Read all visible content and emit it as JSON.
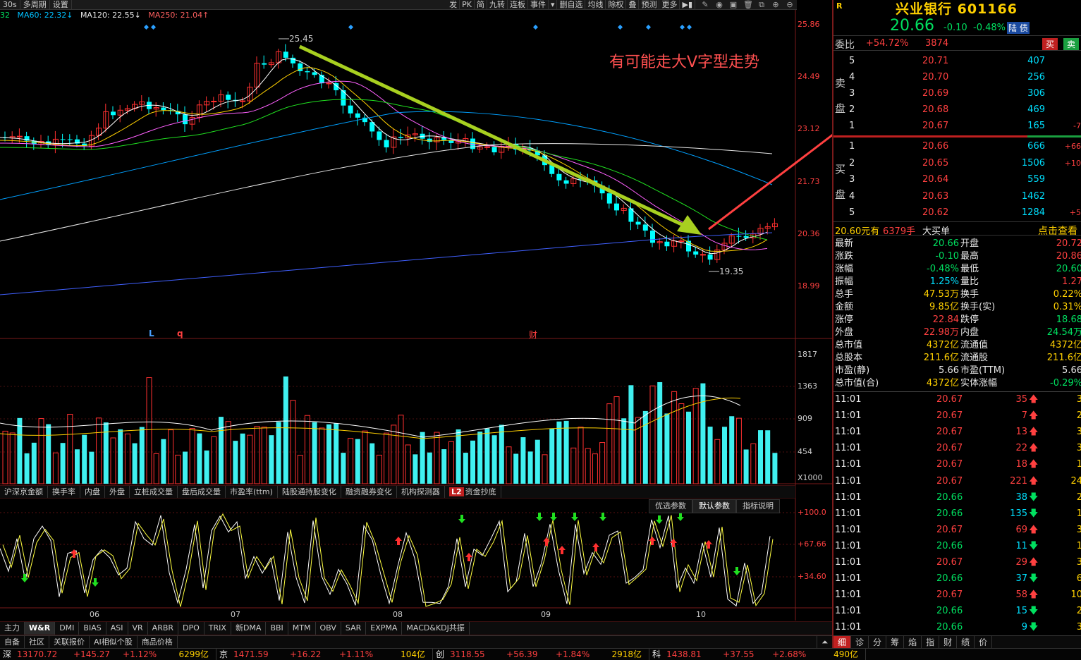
{
  "toolbar": {
    "period": "30s",
    "multi_period": "多周期",
    "settings": "设置",
    "tools": [
      "发",
      "PK",
      "简",
      "九转",
      "连板",
      "事件",
      "▾",
      "删自选",
      "均线",
      "除权",
      "叠",
      "预测",
      "更多",
      "▶▮"
    ]
  },
  "ma_legend": {
    "ma30_suffix": "32",
    "ma60": "MA60: 22.32↓",
    "ma120": "MA120: 22.55↓",
    "ma250": "MA250: 21.04↑",
    "colors": {
      "ma30": "#ffffff",
      "ma60": "#00c0ff",
      "ma120": "#ffffff",
      "ma250": "#ff6060"
    }
  },
  "price_axis": [
    "25.86",
    "24.49",
    "23.12",
    "21.73",
    "20.36",
    "18.99"
  ],
  "chart_annotations": {
    "high_label": "25.45",
    "low_label": "19.35",
    "caption": "有可能走大V字型走势",
    "markers": [
      "L",
      "q",
      "财"
    ]
  },
  "volume_axis": [
    "1817",
    "1363",
    "909",
    "454",
    "X1000"
  ],
  "indicator_tabs": [
    "沪深京金额",
    "换手率",
    "内盘",
    "外盘",
    "立桩成交量",
    "盘后成交量",
    "市盈率(ttm)",
    "陆股通持股变化",
    "融资融券变化",
    "机构探测器",
    "资金抄底"
  ],
  "indicator_badge": "L2",
  "param_tabs": [
    "优选参数",
    "默认参数",
    "指标说明"
  ],
  "wr_axis": [
    "+100.0",
    "+67.66",
    "+34.60"
  ],
  "month_labels": [
    "06",
    "07",
    "08",
    "09",
    "10"
  ],
  "bottom_tabs": [
    "主力",
    "W&R",
    "DMI",
    "BIAS",
    "ASI",
    "VR",
    "ARBR",
    "DPO",
    "TRIX",
    "新DMA",
    "BBI",
    "MTM",
    "OBV",
    "SAR",
    "EXPMA",
    "MACD&KDJ共振"
  ],
  "bottom_tabs2": [
    "自备",
    "社区",
    "关联报价",
    "AI相似个股",
    "商品价格"
  ],
  "status": [
    {
      "name": "深",
      "value": "13170.72",
      "change": "+145.27",
      "pct": "+1.12%",
      "amount": "6299亿"
    },
    {
      "name": "京",
      "value": "1471.59",
      "change": "+16.22",
      "pct": "+1.11%",
      "amount": "104亿"
    },
    {
      "name": "创",
      "value": "3118.55",
      "change": "+56.39",
      "pct": "+1.84%",
      "amount": "2918亿"
    },
    {
      "name": "科",
      "value": "1438.81",
      "change": "+37.55",
      "pct": "+2.68%",
      "amount": "490亿"
    }
  ],
  "quote": {
    "r_label": "R",
    "name": "兴业银行 601166",
    "price": "20.66",
    "change": "-0.10",
    "pct": "-0.48%",
    "tag": "陆 债",
    "weibi_label": "委比",
    "weibi": "+54.72%",
    "weicha": "3874",
    "buy_btn": "买",
    "sell_btn": "卖",
    "sell_label": "卖盘",
    "buy_label": "买盘",
    "asks": [
      {
        "lvl": "5",
        "price": "20.71",
        "vol": "407",
        "extra": ""
      },
      {
        "lvl": "4",
        "price": "20.70",
        "vol": "256",
        "extra": ""
      },
      {
        "lvl": "3",
        "price": "20.69",
        "vol": "306",
        "extra": ""
      },
      {
        "lvl": "2",
        "price": "20.68",
        "vol": "469",
        "extra": ""
      },
      {
        "lvl": "1",
        "price": "20.67",
        "vol": "165",
        "extra": "-7"
      }
    ],
    "bids": [
      {
        "lvl": "1",
        "price": "20.66",
        "vol": "666",
        "extra": "+66"
      },
      {
        "lvl": "2",
        "price": "20.65",
        "vol": "1506",
        "extra": "+10"
      },
      {
        "lvl": "3",
        "price": "20.64",
        "vol": "559",
        "extra": ""
      },
      {
        "lvl": "4",
        "price": "20.63",
        "vol": "1462",
        "extra": ""
      },
      {
        "lvl": "5",
        "price": "20.62",
        "vol": "1284",
        "extra": "+5"
      }
    ],
    "big_order": {
      "price": "20.60元有",
      "hands": "6379手",
      "type": "大买单",
      "link": "点击查看"
    },
    "stats": [
      {
        "k1": "最新",
        "v1": "20.66",
        "c1": "g",
        "k2": "开盘",
        "v2": "20.72",
        "c2": "r"
      },
      {
        "k1": "涨跌",
        "v1": "-0.10",
        "c1": "g",
        "k2": "最高",
        "v2": "20.86",
        "c2": "r"
      },
      {
        "k1": "涨幅",
        "v1": "-0.48%",
        "c1": "g",
        "k2": "最低",
        "v2": "20.60",
        "c2": "g"
      },
      {
        "k1": "振幅",
        "v1": "1.25%",
        "c1": "c",
        "k2": "量比",
        "v2": "1.27",
        "c2": "r"
      },
      {
        "k1": "总手",
        "v1": "47.53万",
        "c1": "y",
        "k2": "换手",
        "v2": "0.22%",
        "c2": "y"
      },
      {
        "k1": "金额",
        "v1": "9.85亿",
        "c1": "y",
        "k2": "换手(实)",
        "v2": "0.31%",
        "c2": "y"
      },
      {
        "k1": "涨停",
        "v1": "22.84",
        "c1": "r",
        "k2": "跌停",
        "v2": "18.68",
        "c2": "g"
      },
      {
        "k1": "外盘",
        "v1": "22.98万",
        "c1": "r",
        "k2": "内盘",
        "v2": "24.54万",
        "c2": "g"
      },
      {
        "k1": "总市值",
        "v1": "4372亿",
        "c1": "y",
        "k2": "流通值",
        "v2": "4372亿",
        "c2": "y"
      },
      {
        "k1": "总股本",
        "v1": "211.6亿",
        "c1": "y",
        "k2": "流通股",
        "v2": "211.6亿",
        "c2": "y"
      },
      {
        "k1": "市盈(静)",
        "v1": "5.66",
        "c1": "w",
        "k2": "市盈(TTM)",
        "v2": "5.66",
        "c2": "w"
      },
      {
        "k1": "总市值(合)",
        "v1": "4372亿",
        "c1": "y",
        "k2": "实体涨幅",
        "v2": "-0.29%",
        "c2": "g"
      }
    ],
    "ticks": [
      {
        "time": "11:01",
        "price": "20.67",
        "vol": "35",
        "dir": "up",
        "extra": "3"
      },
      {
        "time": "11:01",
        "price": "20.67",
        "vol": "7",
        "dir": "up",
        "extra": "2"
      },
      {
        "time": "11:01",
        "price": "20.67",
        "vol": "13",
        "dir": "up",
        "extra": "3"
      },
      {
        "time": "11:01",
        "price": "20.67",
        "vol": "22",
        "dir": "up",
        "extra": "3"
      },
      {
        "time": "11:01",
        "price": "20.67",
        "vol": "18",
        "dir": "up",
        "extra": "1"
      },
      {
        "time": "11:01",
        "price": "20.67",
        "vol": "221",
        "dir": "up",
        "extra": "24"
      },
      {
        "time": "11:01",
        "price": "20.66",
        "vol": "38",
        "dir": "down",
        "extra": "2"
      },
      {
        "time": "11:01",
        "price": "20.66",
        "vol": "135",
        "dir": "down",
        "extra": "1"
      },
      {
        "time": "11:01",
        "price": "20.67",
        "vol": "69",
        "dir": "up",
        "extra": "3"
      },
      {
        "time": "11:01",
        "price": "20.66",
        "vol": "11",
        "dir": "down",
        "extra": "1"
      },
      {
        "time": "11:01",
        "price": "20.67",
        "vol": "29",
        "dir": "up",
        "extra": "3"
      },
      {
        "time": "11:01",
        "price": "20.66",
        "vol": "37",
        "dir": "down",
        "extra": "6"
      },
      {
        "time": "11:01",
        "price": "20.67",
        "vol": "58",
        "dir": "up",
        "extra": "10"
      },
      {
        "time": "11:01",
        "price": "20.66",
        "vol": "15",
        "dir": "down",
        "extra": "2"
      },
      {
        "time": "11:01",
        "price": "20.66",
        "vol": "9",
        "dir": "down",
        "extra": "3"
      }
    ],
    "right_tabs": [
      "细",
      "诊",
      "分",
      "筹",
      "焰",
      "指",
      "财",
      "绩",
      "价"
    ]
  },
  "colors": {
    "up": "#ff3030",
    "down": "#00ffff",
    "bg": "#000000",
    "grid": "#5a1010"
  }
}
